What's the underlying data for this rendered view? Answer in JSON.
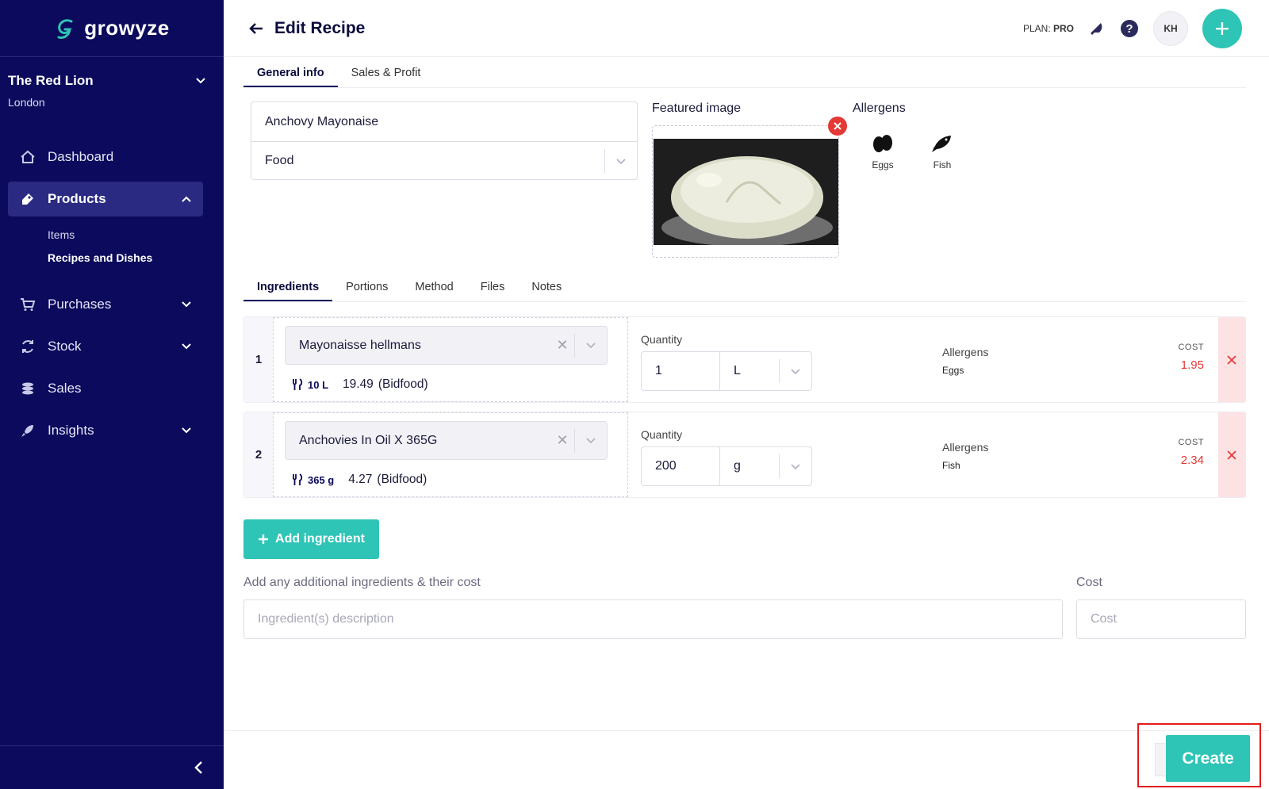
{
  "app": {
    "brand": "growyze"
  },
  "venue": {
    "name": "The Red Lion",
    "city": "London"
  },
  "sidebar": {
    "items": [
      {
        "label": "Dashboard",
        "icon": "home-icon"
      },
      {
        "label": "Products",
        "icon": "tag-icon",
        "expanded": true
      },
      {
        "label": "Purchases",
        "icon": "cart-icon"
      },
      {
        "label": "Stock",
        "icon": "refresh-icon"
      },
      {
        "label": "Sales",
        "icon": "coins-icon"
      },
      {
        "label": "Insights",
        "icon": "rocket-icon"
      }
    ],
    "products_sub": [
      "Items",
      "Recipes and Dishes"
    ]
  },
  "header": {
    "title": "Edit Recipe",
    "plan_label": "PLAN:",
    "plan_value": "PRO",
    "avatar": "KH"
  },
  "tabs": {
    "top": [
      "General info",
      "Sales & Profit"
    ],
    "sub": [
      "Ingredients",
      "Portions",
      "Method",
      "Files",
      "Notes"
    ]
  },
  "recipe": {
    "name": "Anchovy Mayonaise",
    "category": "Food",
    "featured_label": "Featured image",
    "allergens_label": "Allergens",
    "allergens": [
      {
        "label": "Eggs",
        "icon": "egg-icon"
      },
      {
        "label": "Fish",
        "icon": "fish-icon"
      }
    ]
  },
  "ingredients": [
    {
      "num": "1",
      "name": "Mayonaisse hellmans",
      "size": "10 L",
      "price": "19.49",
      "supplier": "(Bidfood)",
      "qty_label": "Quantity",
      "qty": "1",
      "unit": "L",
      "alg_label": "Allergens",
      "alg": "Eggs",
      "cost_label": "COST",
      "cost": "1.95"
    },
    {
      "num": "2",
      "name": "Anchovies In Oil X 365G",
      "size": "365 g",
      "price": "4.27",
      "supplier": "(Bidfood)",
      "qty_label": "Quantity",
      "qty": "200",
      "unit": "g",
      "alg_label": "Allergens",
      "alg": "Fish",
      "cost_label": "COST",
      "cost": "2.34"
    }
  ],
  "actions": {
    "add_ingredient": "Add ingredient",
    "extra_label": "Add any additional ingredients & their cost",
    "extra_placeholder": "Ingredient(s) description",
    "cost_label": "Cost",
    "cost_placeholder": "Cost",
    "create": "Create"
  },
  "colors": {
    "sidebar": "#0b0a5c",
    "accent": "#2ec4b6",
    "danger": "#e53935"
  }
}
